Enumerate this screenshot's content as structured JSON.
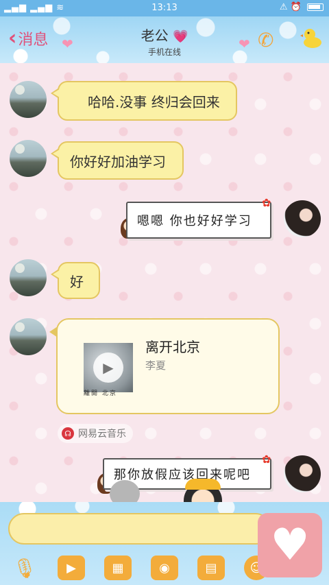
{
  "status_bar": {
    "signal": "…… ……",
    "time": "13:13"
  },
  "header": {
    "back_label": "消息",
    "contact_name": "老公",
    "contact_status": "手机在线"
  },
  "messages": [
    {
      "side": "left",
      "text": "哈哈.没事 终归会回来"
    },
    {
      "side": "left",
      "text": "你好好加油学习"
    },
    {
      "side": "right",
      "text": "嗯嗯 你也好好学习"
    },
    {
      "side": "left",
      "text": "好"
    },
    {
      "side": "right",
      "text": "那你放假应该回来呢吧"
    }
  ],
  "music_card": {
    "song_title": "离开北京",
    "artist": "李夏",
    "album_text": "離開 北京",
    "source": "网易云音乐"
  },
  "icons": {
    "back": "chevron-left-icon",
    "call": "phone-icon",
    "duck": "duck-icon",
    "voice": "microphone-icon",
    "video": "video-icon",
    "image": "picture-icon",
    "camera": "camera-icon",
    "file": "folder-icon",
    "favorite": "heart-icon"
  },
  "colors": {
    "accent": "#e0517a",
    "bubble": "#fbf1a6",
    "bubble_border": "#e4c661",
    "header": "#9fd6f4",
    "tool": "#f3ac3b"
  }
}
